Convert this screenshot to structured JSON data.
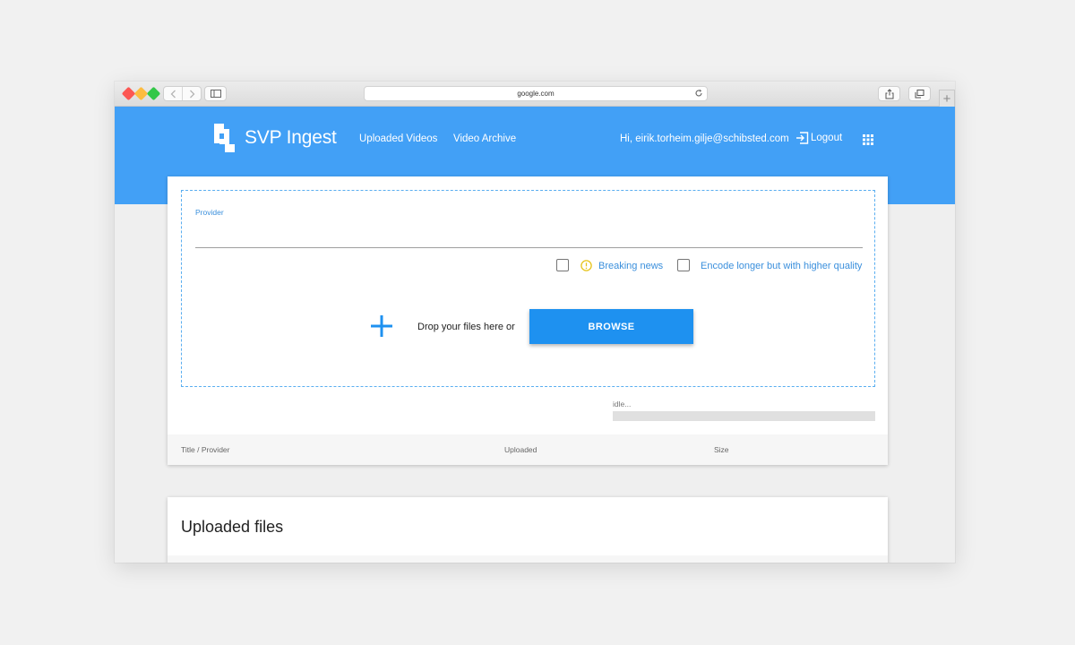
{
  "browser": {
    "url": "google.com",
    "newtab_label": "+"
  },
  "app": {
    "brand": "SVP Ingest",
    "nav": {
      "uploaded_videos": "Uploaded Videos",
      "video_archive": "Video Archive"
    },
    "user_greeting": "Hi, eirik.torheim.gilje@schibsted.com",
    "logout_label": "Logout",
    "header_color": "#42a0f6",
    "accent_color": "#1e91f0"
  },
  "upload": {
    "provider_label": "Provider",
    "provider_value": "",
    "options": {
      "breaking_news": {
        "label": "Breaking news",
        "checked": false
      },
      "encode_quality": {
        "label": "Encode longer but with higher quality",
        "checked": false
      }
    },
    "drop_text": "Drop your files here or",
    "browse_label": "BROWSE",
    "status_text": "idle...",
    "progress_fraction": 0
  },
  "table": {
    "columns": [
      "Title / Provider",
      "Uploaded",
      "Size"
    ]
  },
  "files_section": {
    "title": "Uploaded files"
  }
}
